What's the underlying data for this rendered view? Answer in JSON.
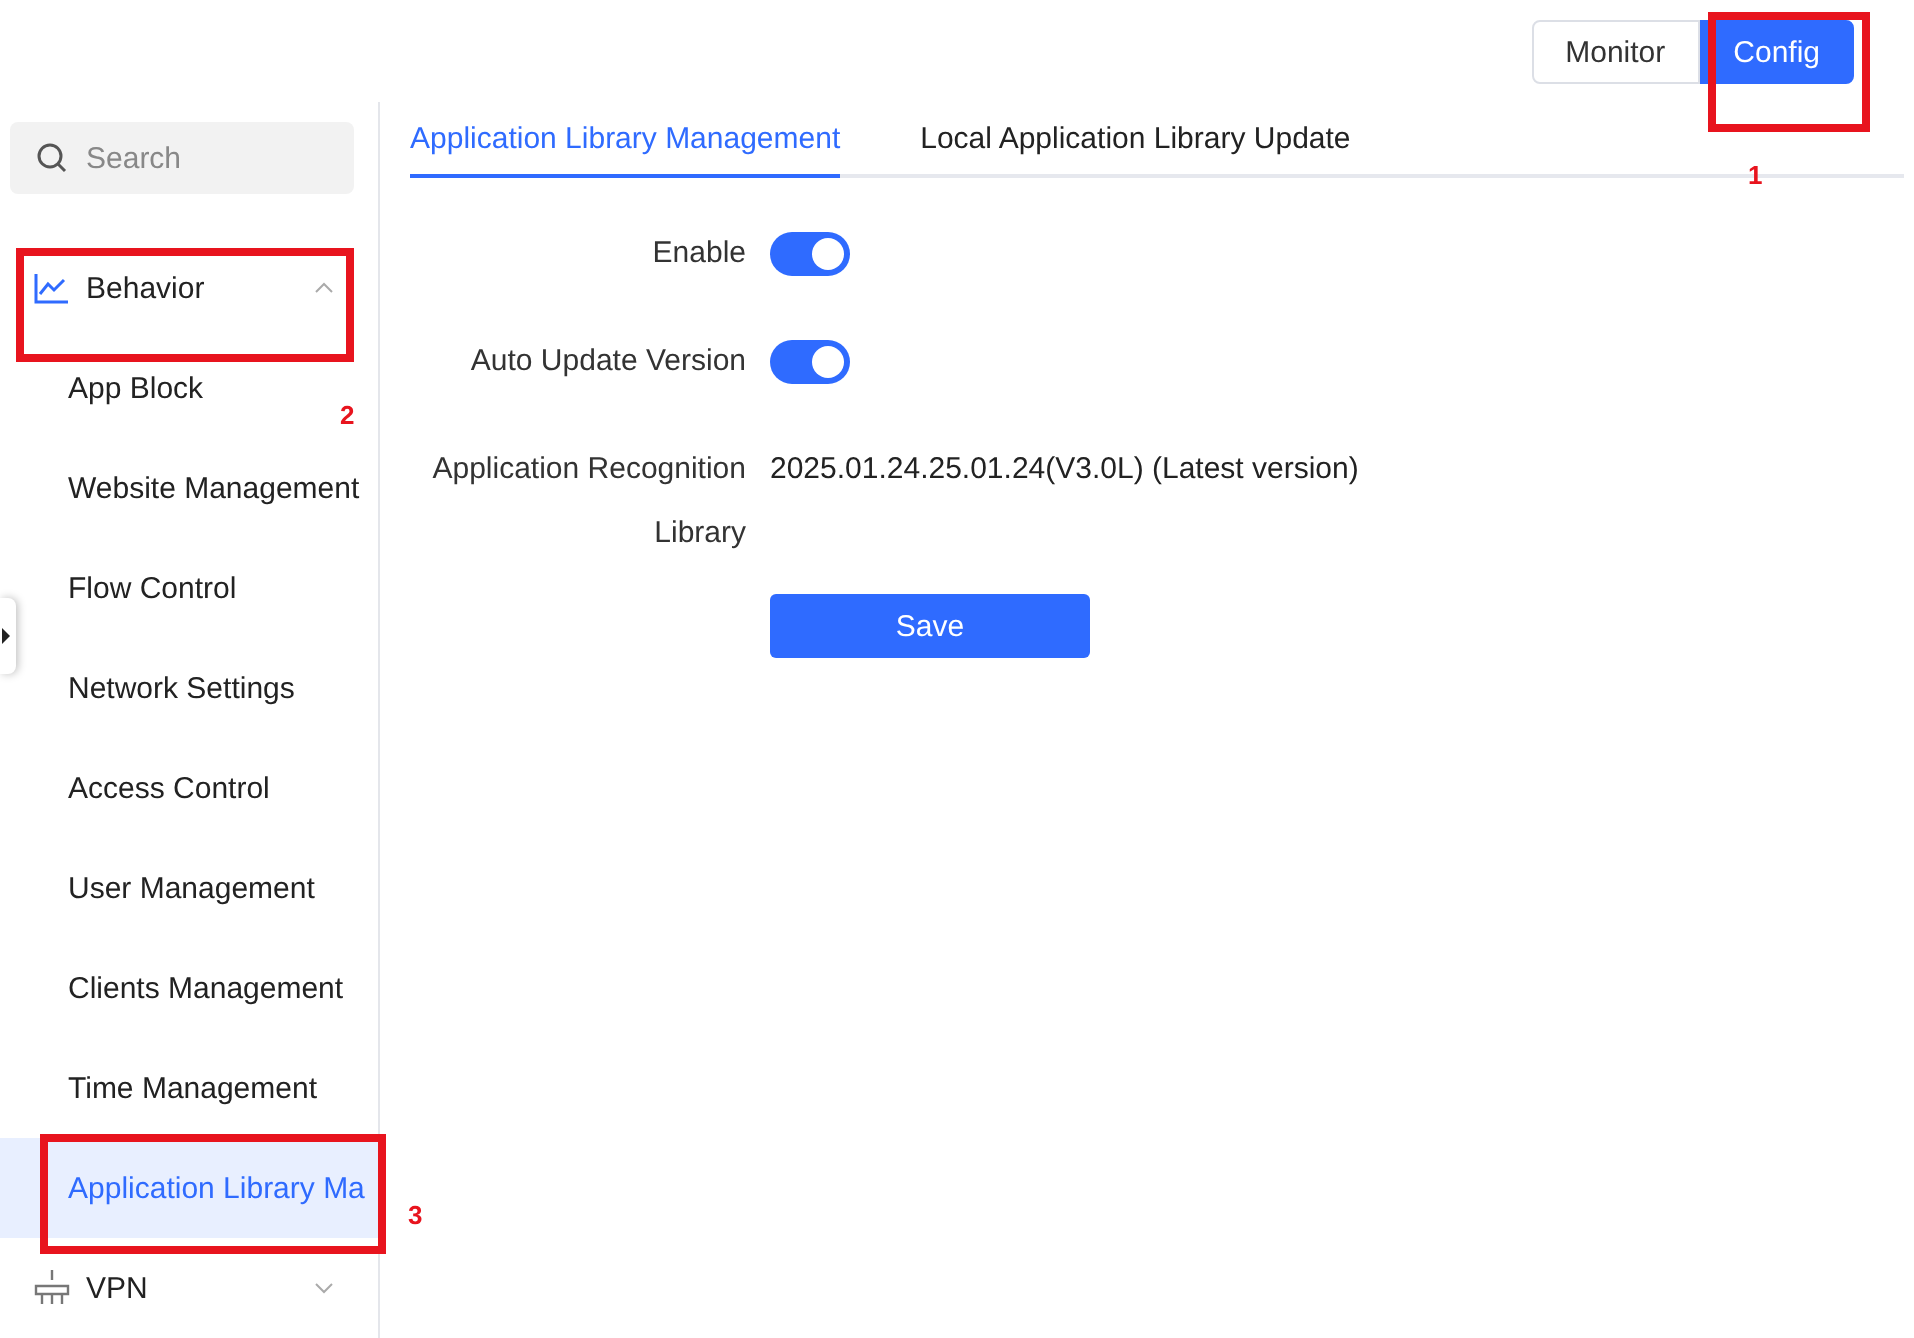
{
  "mode_switch": [
    {
      "label": "Monitor",
      "selected": false
    },
    {
      "label": "Config",
      "selected": true
    }
  ],
  "sidebar": {
    "search": {
      "placeholder": "Search"
    },
    "items": [
      {
        "label": "Behavior",
        "expanded": true,
        "children": [
          {
            "label": "App Block",
            "selected": false
          },
          {
            "label": "Website Management",
            "selected": false
          },
          {
            "label": "Flow Control",
            "selected": false
          },
          {
            "label": "Network Settings",
            "selected": false
          },
          {
            "label": "Access Control",
            "selected": false
          },
          {
            "label": "User Management",
            "selected": false
          },
          {
            "label": "Clients Management",
            "selected": false
          },
          {
            "label": "Time Management",
            "selected": false
          },
          {
            "label": "Application Library Ma",
            "selected": true
          }
        ]
      },
      {
        "label": "VPN",
        "expanded": false
      }
    ]
  },
  "tabs": [
    {
      "label": "Application Library Management",
      "selected": true
    },
    {
      "label": "Local Application Library Update",
      "selected": false
    }
  ],
  "form": [
    {
      "kind": "switch",
      "label": "Enable",
      "on": true
    },
    {
      "kind": "switch",
      "label": "Auto Update Version",
      "on": true
    },
    {
      "kind": "text",
      "label": "Application Recognition Library",
      "value": "2025.01.24.25.01.24(V3.0L) (Latest version)"
    }
  ],
  "save_button": "Save",
  "annotations": [
    "1",
    "2",
    "3"
  ]
}
